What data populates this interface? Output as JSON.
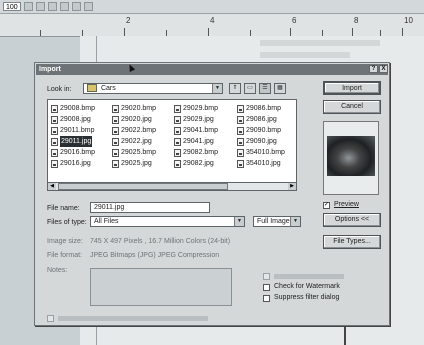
{
  "toolbar": {
    "zoom": "100"
  },
  "ruler": {
    "numbers": [
      "2",
      "4",
      "6",
      "8",
      "10"
    ]
  },
  "dialog": {
    "title": "Import",
    "help_button": "?",
    "close_button": "X",
    "look_in_label": "Look in:",
    "look_in_value": "Cars",
    "view_buttons": [
      "up-folder-icon",
      "new-folder-icon",
      "list-view-icon",
      "details-view-icon"
    ],
    "files": {
      "col1": [
        "29008.bmp",
        "29008.jpg",
        "29011.bmp",
        "29011.jpg",
        "29016.bmp",
        "29016.jpg"
      ],
      "col2": [
        "29020.bmp",
        "29020.jpg",
        "29022.bmp",
        "29022.jpg",
        "29025.bmp",
        "29025.jpg"
      ],
      "col3": [
        "29029.bmp",
        "29029.jpg",
        "29041.bmp",
        "29041.jpg",
        "29082.bmp",
        "29082.jpg"
      ],
      "col4": [
        "29086.bmp",
        "29086.jpg",
        "29090.bmp",
        "29090.jpg",
        "354010.bmp",
        "354010.jpg"
      ],
      "selected": "29011.jpg"
    },
    "file_name_label": "File name:",
    "file_name_value": "29011.jpg",
    "files_of_type_label": "Files of type:",
    "files_of_type_value": "All Files",
    "image_mode_value": "Full Image",
    "image_size_label": "Image size:",
    "image_size_value": "745 X 497 Pixels , 16.7 Million Colors (24-bit)",
    "file_format_label": "File format:",
    "file_format_value": "JPEG Bitmaps (JPG) JPEG Compression",
    "notes_label": "Notes:",
    "import_button": "Import",
    "cancel_button": "Cancel",
    "preview_label": "Preview",
    "options_button": "Options <<",
    "file_types_button": "File Types...",
    "check_watermark_label": "Check for Watermark",
    "suppress_filter_label": "Suppress filter dialog"
  }
}
